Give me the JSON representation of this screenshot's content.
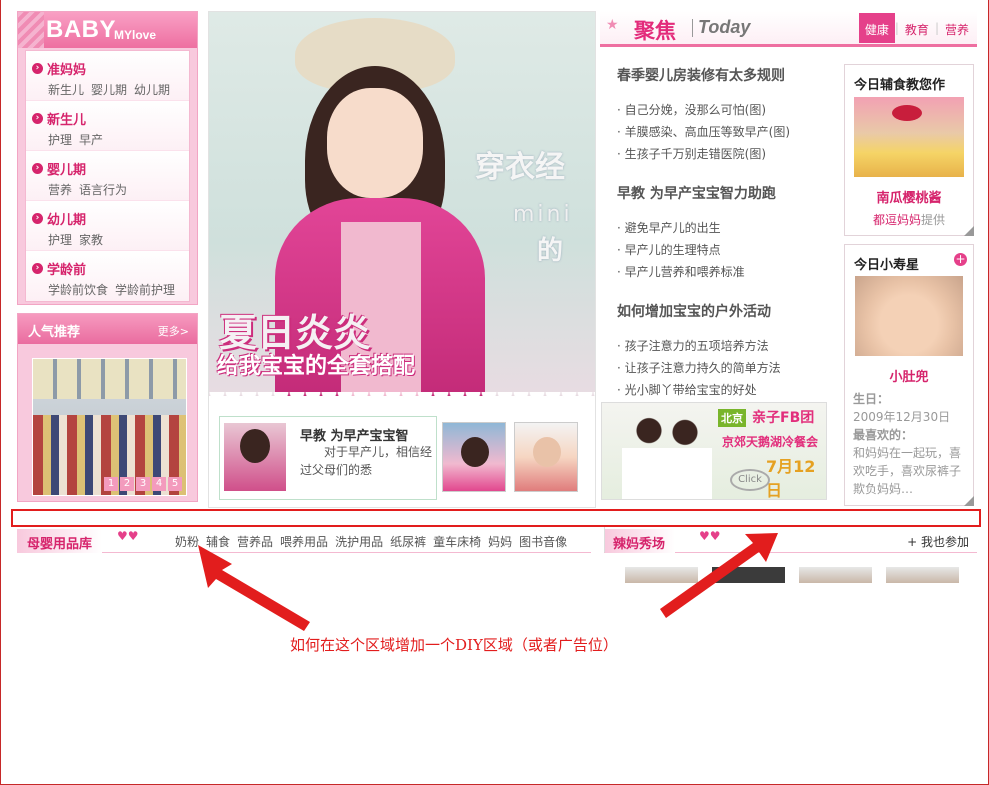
{
  "left_nav": {
    "brand": "BABY",
    "brand_sub": "MYlove",
    "items": [
      {
        "title": "准妈妈",
        "subs": [
          "新生儿",
          "婴儿期",
          "幼儿期"
        ]
      },
      {
        "title": "新生儿",
        "subs": [
          "护理",
          "早产"
        ]
      },
      {
        "title": "婴儿期",
        "subs": [
          "营养",
          "语言行为"
        ]
      },
      {
        "title": "幼儿期",
        "subs": [
          "护理",
          "家教"
        ]
      },
      {
        "title": "学龄前",
        "subs": [
          "学龄前饮食",
          "学龄前护理"
        ]
      }
    ]
  },
  "popular": {
    "title": "人气推荐",
    "more": "更多>",
    "pages": [
      "1",
      "2",
      "3",
      "4",
      "5"
    ]
  },
  "hero": {
    "title": "夏日炎炎",
    "subtitle": "给我宝宝的全套搭配",
    "deco1": "穿衣经",
    "deco2": "mini",
    "deco3": "的"
  },
  "mini_card": {
    "title": "早教 为早产宝宝智",
    "desc": "对于早产儿，相信经过父母们的悉"
  },
  "focus": {
    "title": "聚焦",
    "today": "Today",
    "tabs": [
      "健康",
      "教育",
      "营养"
    ],
    "active_tab": 0,
    "groups": [
      {
        "title": "春季婴儿房装修有太多规则",
        "lines": [
          "自己分娩，没那么可怕(图)",
          "羊膜感染、高血压等致早产(图)",
          "生孩子千万别走错医院(图)"
        ]
      },
      {
        "title": "早教 为早产宝宝智力助跑",
        "lines": [
          "避免早产儿的出生",
          "早产儿的生理特点",
          "早产儿营养和喂养标准"
        ]
      },
      {
        "title": "如何增加宝宝的户外活动",
        "lines": [
          "孩子注意力的五项培养方法",
          "让孩子注意力持久的简单方法",
          "光小脚丫带给宝宝的好处"
        ]
      }
    ]
  },
  "card_food": {
    "title": "今日辅食教您作",
    "name": "南瓜樱桃酱",
    "provider_name": "都逗妈妈",
    "provider_suffix": "提供"
  },
  "card_star": {
    "title": "今日小寿星",
    "name": "小肚兜",
    "birthday_label": "生日：",
    "birthday": "2009年12月30日",
    "likes_label": "最喜欢的：",
    "likes": "和妈妈在一起玩，喜欢吃手，喜欢尿裤子欺负妈妈…"
  },
  "ad": {
    "tag_city": "北京",
    "tag_name": "亲子FB团",
    "line": "京郊天鹅湖冷餐会",
    "date": "7月12日",
    "click": "Click"
  },
  "mall": {
    "title": "母婴用品库",
    "links": [
      "奶粉",
      "辅食",
      "营养品",
      "喂养用品",
      "洗护用品",
      "纸尿裤",
      "童车床椅",
      "妈妈",
      "图书音像"
    ]
  },
  "show": {
    "title": "辣妈秀场",
    "join": "+ 我也参加"
  },
  "annotation": {
    "caption": "如何在这个区域增加一个DIY区域（或者广告位）",
    "color": "#e21d1d"
  }
}
